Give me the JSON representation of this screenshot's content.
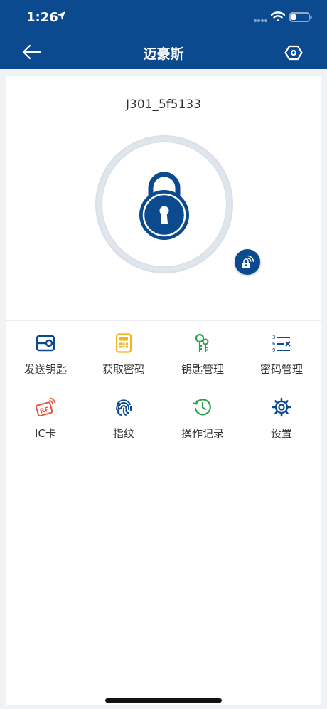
{
  "status_bar": {
    "time": "1:26",
    "location_icon": "location-arrow-icon",
    "signal_icon": "cellular-signal-icon",
    "wifi_icon": "wifi-icon",
    "battery_icon": "battery-icon"
  },
  "nav": {
    "title": "迈豪斯",
    "back_icon": "back-arrow-icon",
    "settings_icon": "hexagon-settings-icon"
  },
  "device": {
    "name": "J301_5f5133",
    "lock_icon": "padlock-icon",
    "remote_icon": "remote-unlock-icon"
  },
  "colors": {
    "primary": "#0b4a8f",
    "send_key": "#0b4a8f",
    "get_password": "#f2b41f",
    "key_manage": "#2ca24a",
    "password_manage": "#0b4a8f",
    "ic_card": "#e9533a",
    "fingerprint": "#0b4a8f",
    "records": "#2ca24a",
    "settings": "#0b4a8f"
  },
  "menu": [
    {
      "label": "发送钥匙",
      "icon": "send-key-icon"
    },
    {
      "label": "获取密码",
      "icon": "calculator-icon"
    },
    {
      "label": "钥匙管理",
      "icon": "keys-icon"
    },
    {
      "label": "密码管理",
      "icon": "password-list-icon"
    },
    {
      "label": "IC卡",
      "icon": "rf-card-icon"
    },
    {
      "label": "指纹",
      "icon": "fingerprint-icon"
    },
    {
      "label": "操作记录",
      "icon": "history-icon"
    },
    {
      "label": "设置",
      "icon": "gear-icon"
    }
  ]
}
